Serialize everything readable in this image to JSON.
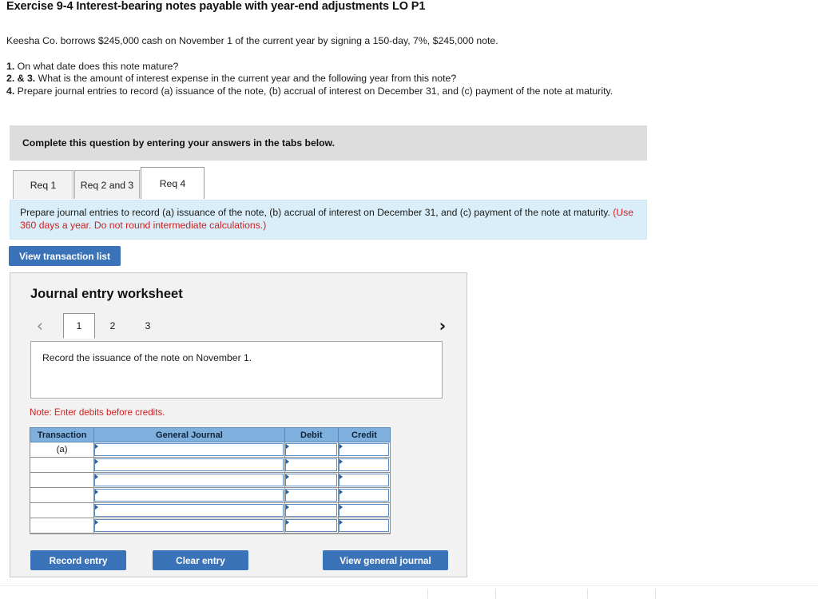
{
  "exercise": {
    "title": "Exercise 9-4 Interest-bearing notes payable with year-end adjustments LO P1",
    "intro": "Keesha Co. borrows $245,000 cash on November 1 of the current year by signing a 150-day, 7%, $245,000 note.",
    "requirements": [
      {
        "num": "1.",
        "text": " On what date does this note mature?"
      },
      {
        "num": "2. & 3.",
        "text": " What is the amount of interest expense in the current year and the following year from this note?"
      },
      {
        "num": "4.",
        "text": " Prepare journal entries to record (a) issuance of the note, (b) accrual of interest on December 31, and (c) payment of the note at maturity."
      }
    ]
  },
  "banner": {
    "text": "Complete this question by entering your answers in the tabs below."
  },
  "tabs": [
    {
      "label": "Req 1",
      "active": false
    },
    {
      "label": "Req 2 and 3",
      "active": false
    },
    {
      "label": "Req 4",
      "active": true
    }
  ],
  "requirement_box": {
    "text": "Prepare journal entries to record (a) issuance of the note, (b) accrual of interest on December 31, and (c) payment of the note at maturity. ",
    "hint": "(Use 360 days a year. Do not round intermediate calculations.)"
  },
  "view_transaction_list": {
    "label": "View transaction list"
  },
  "worksheet": {
    "title": "Journal entry worksheet",
    "pager": {
      "prev_icon": "chevron-left-icon",
      "next_icon": "chevron-right-icon",
      "pages": [
        {
          "label": "1",
          "active": true
        },
        {
          "label": "2",
          "active": false
        },
        {
          "label": "3",
          "active": false
        }
      ]
    },
    "description": "Record the issuance of the note on November 1.",
    "note": "Note: Enter debits before credits.",
    "table": {
      "headers": [
        "Transaction",
        "General Journal",
        "Debit",
        "Credit"
      ],
      "rows": [
        {
          "transaction": "(a)",
          "general_journal": "",
          "debit": "",
          "credit": ""
        },
        {
          "transaction": "",
          "general_journal": "",
          "debit": "",
          "credit": ""
        },
        {
          "transaction": "",
          "general_journal": "",
          "debit": "",
          "credit": ""
        },
        {
          "transaction": "",
          "general_journal": "",
          "debit": "",
          "credit": ""
        },
        {
          "transaction": "",
          "general_journal": "",
          "debit": "",
          "credit": ""
        },
        {
          "transaction": "",
          "general_journal": "",
          "debit": "",
          "credit": ""
        }
      ]
    },
    "buttons": {
      "record": "Record entry",
      "clear": "Clear entry",
      "view_journal": "View general journal"
    }
  },
  "colors": {
    "accent_blue": "#3b73b9",
    "table_header_blue": "#7fb0dd",
    "hint_red": "#cc2222",
    "info_box_blue": "#d9eef8",
    "banner_gray": "#dddddd",
    "panel_gray": "#f2f2f2"
  }
}
